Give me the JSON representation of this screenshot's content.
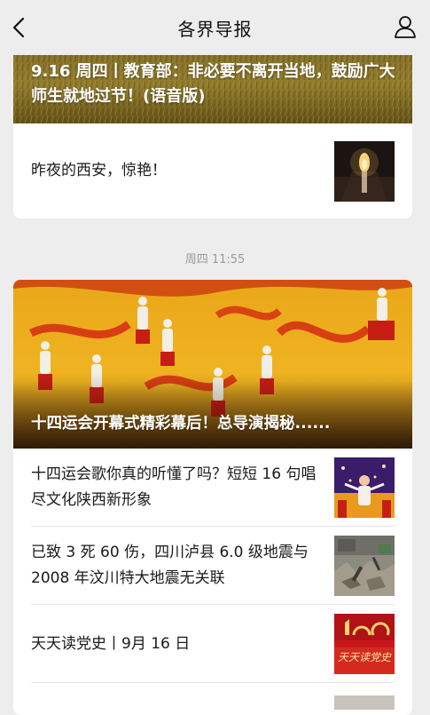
{
  "header": {
    "title": "各界导报",
    "back_icon": "chevron-left-icon",
    "profile_icon": "person-icon"
  },
  "messages": [
    {
      "hero_title": "9.16 周四丨教育部：非必要不离开当地，鼓励广大师生就地过节！(语音版)",
      "items": [
        {
          "title": "昨夜的西安，惊艳！"
        }
      ]
    },
    {
      "timestamp": "周四 11:55",
      "hero_title": "十四运会开幕式精彩幕后！总导演揭秘......",
      "items": [
        {
          "title": "十四运会歌你真的听懂了吗？短短 16 句唱尽文化陕西新形象"
        },
        {
          "title": "已致 3 死 60 伤，四川泸县 6.0 级地震与 2008 年汶川特大地震无关联"
        },
        {
          "title": "天天读党史丨9月 16 日",
          "thumb_text": "天天读党史"
        }
      ]
    }
  ],
  "colors": {
    "background": "#ededed",
    "card": "#ffffff",
    "accent_red": "#c8181c"
  }
}
